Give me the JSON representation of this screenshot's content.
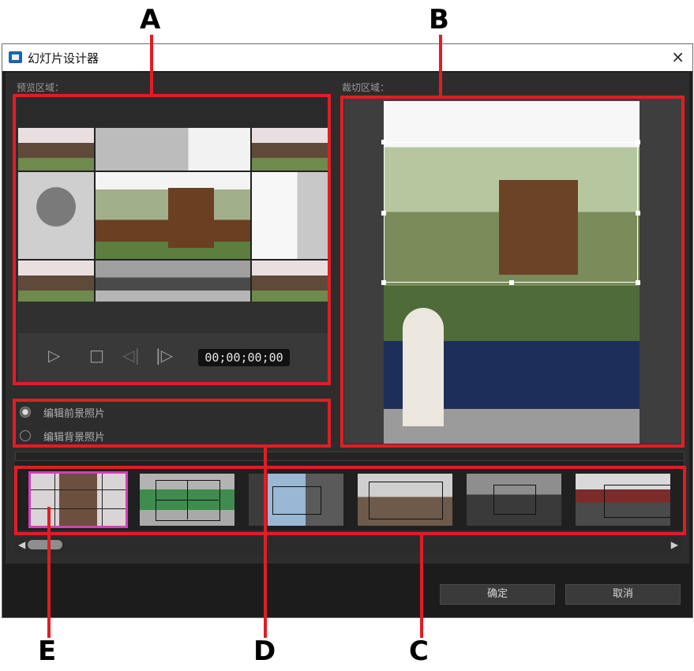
{
  "callouts": {
    "a": "A",
    "b": "B",
    "c": "C",
    "d": "D",
    "e": "E"
  },
  "window": {
    "title": "幻灯片设计器",
    "close_glyph": "×",
    "app_icon": "slideshow-designer-app-icon"
  },
  "preview": {
    "label": "预览区域：",
    "timecode": "00;00;00;00"
  },
  "controls": {
    "play_glyph": "▷",
    "stop_glyph": "□",
    "prev_frame_glyph": "◁|",
    "next_frame_glyph": "|▷"
  },
  "crop": {
    "label": "裁切区域："
  },
  "edit_options": [
    {
      "label": "编辑前景照片",
      "selected": true
    },
    {
      "label": "编辑背景照片",
      "selected": false
    }
  ],
  "thumbnails": [
    {
      "name": "layout-grid-windmill",
      "selected": true
    },
    {
      "name": "layout-four-boxes",
      "selected": false
    },
    {
      "name": "layout-center-box",
      "selected": false
    },
    {
      "name": "layout-wide-box",
      "selected": false
    },
    {
      "name": "layout-street-box",
      "selected": false
    },
    {
      "name": "layout-top-band",
      "selected": false
    }
  ],
  "scroll": {
    "left_glyph": "◀",
    "right_glyph": "▶"
  },
  "buttons": {
    "ok": "确定",
    "cancel": "取消"
  },
  "colors": {
    "callout_red": "#e11d24",
    "selection_pink": "#d43fba",
    "dialog_bg": "#2d2d2d"
  }
}
